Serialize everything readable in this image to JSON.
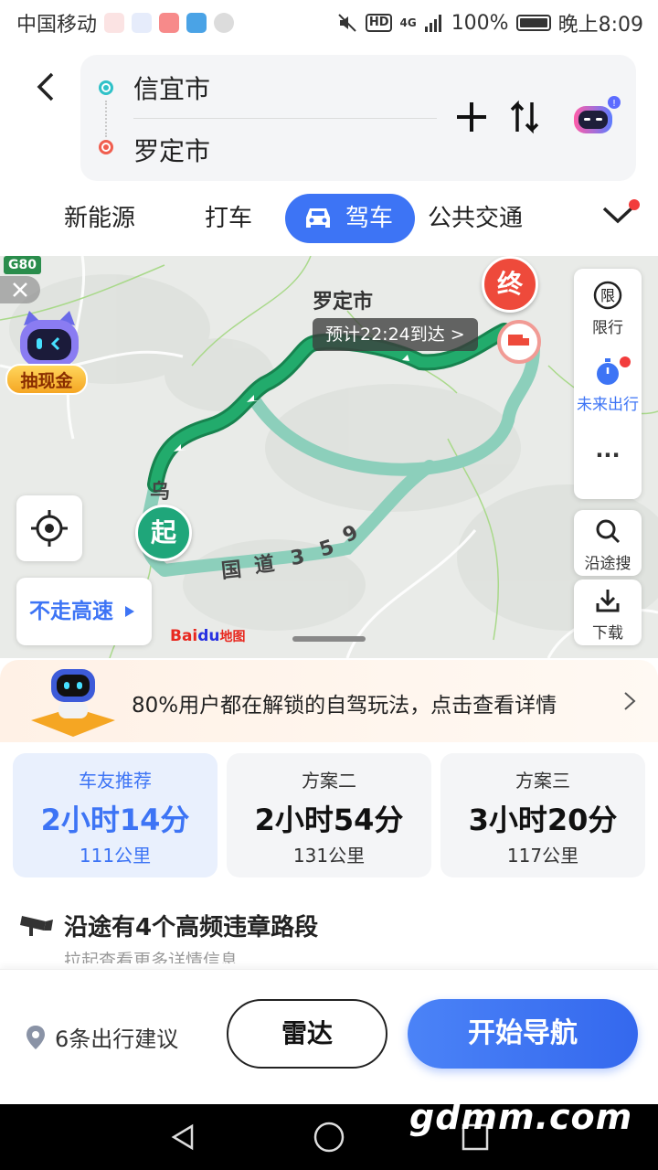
{
  "status_bar": {
    "carrier": "中国移动",
    "network": "4G",
    "hd": "HD",
    "battery": "100%",
    "time": "晚上8:09"
  },
  "route": {
    "from": "信宜市",
    "to": "罗定市",
    "add_icon": "plus-icon",
    "swap_icon": "swap-icon",
    "assistant_icon": "assistant-robot-icon"
  },
  "modes": {
    "items": [
      "新能源",
      "打车",
      "驾车",
      "公共交通"
    ],
    "active": "驾车"
  },
  "map": {
    "g80": "G80",
    "cash_label": "抽现金",
    "city_label": "罗定市",
    "eta": "预计22:24到达 >",
    "start_label": "起",
    "end_label": "终",
    "road_label": "国道359",
    "road_chars": [
      "国",
      "道",
      "3",
      "5",
      "9"
    ],
    "wu_label": "乌",
    "restrict_label": "限行",
    "future_label": "未来出行",
    "more_label": "···",
    "search_along_label": "沿途搜",
    "download_label": "下载",
    "no_highway_label": "不走高速",
    "baidu_logo_a": "Bai",
    "baidu_logo_b": "du",
    "baidu_logo_c": "地图",
    "route_color": "#1f9d6c",
    "alt_route_color": "#8ccfbb"
  },
  "promo": {
    "text": "80%用户都在解锁的自驾玩法，点击查看详情"
  },
  "plans": [
    {
      "name": "车友推荐",
      "time": "2小时14分",
      "distance": "111公里",
      "active": true
    },
    {
      "name": "方案二",
      "time": "2小时54分",
      "distance": "131公里",
      "active": false
    },
    {
      "name": "方案三",
      "time": "3小时20分",
      "distance": "117公里",
      "active": false
    }
  ],
  "violation": {
    "title": "沿途有4个高频违章路段",
    "subtitle": "拉起查看更多详情信息"
  },
  "actions": {
    "suggestions": "6条出行建议",
    "radar": "雷达",
    "navigate": "开始导航"
  },
  "watermark": "gdmm.com",
  "colors": {
    "accent": "#3d74f5",
    "start": "#1fa67a",
    "end": "#ee4a3b"
  }
}
